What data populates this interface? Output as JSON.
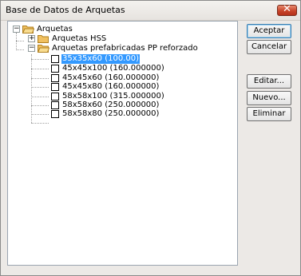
{
  "window": {
    "title": "Base de Datos de Arquetas",
    "close_glyph": "✕"
  },
  "tree": {
    "root": {
      "label": "Arquetas",
      "expander": "−"
    },
    "children": [
      {
        "label": "Arquetas HSS",
        "expander": "+"
      },
      {
        "label": "Arquetas prefabricadas PP reforzado",
        "expander": "−"
      }
    ],
    "leaves": [
      {
        "label": "35x35x60 (100.00)",
        "selected": true
      },
      {
        "label": "45x45x100 (160.000000)"
      },
      {
        "label": "45x45x60 (160.000000)"
      },
      {
        "label": "45x45x80 (160.000000)"
      },
      {
        "label": "58x58x100 (315.000000)"
      },
      {
        "label": "58x58x60 (250.000000)"
      },
      {
        "label": "58x58x80 (250.000000)"
      }
    ]
  },
  "buttons": {
    "accept": "Aceptar",
    "cancel": "Cancelar",
    "edit": "Editar...",
    "new": "Nuevo...",
    "delete": "Eliminar"
  },
  "colors": {
    "selection": "#3399ff",
    "folder": "#f0c060",
    "close": "#c8442a"
  }
}
